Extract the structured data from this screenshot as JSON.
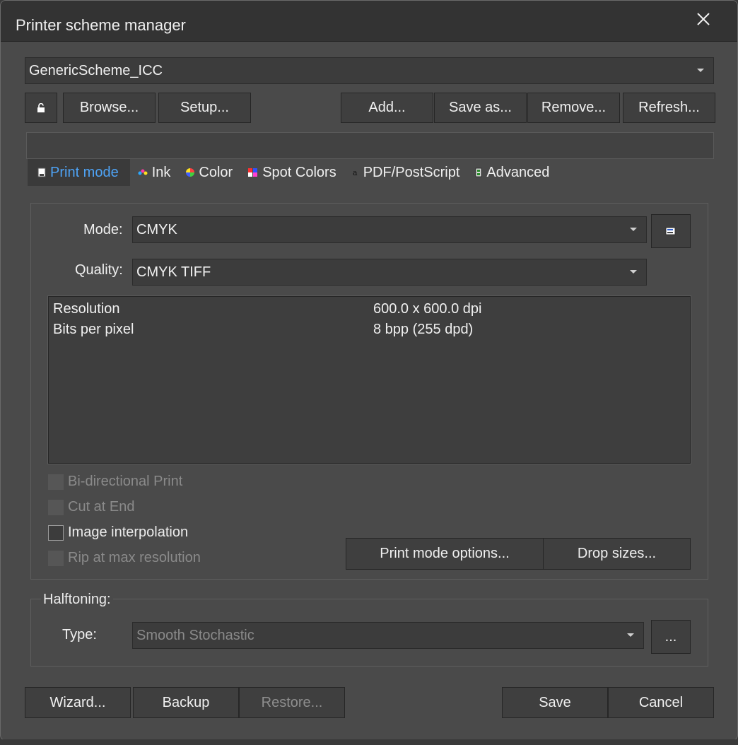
{
  "window": {
    "title": "Printer scheme manager"
  },
  "scheme": {
    "selected": "GenericScheme_ICC"
  },
  "toolbar": {
    "browse": "Browse...",
    "setup": "Setup...",
    "add": "Add...",
    "save_as": "Save as...",
    "remove": "Remove...",
    "refresh": "Refresh..."
  },
  "tabs": [
    {
      "label": "Print mode",
      "icon": "printer-icon"
    },
    {
      "label": "Ink",
      "icon": "ink-drops-icon"
    },
    {
      "label": "Color",
      "icon": "color-wheel-icon"
    },
    {
      "label": "Spot Colors",
      "icon": "spot-colors-icon"
    },
    {
      "label": "PDF/PostScript",
      "icon": "pdf-postscript-icon"
    },
    {
      "label": "Advanced",
      "icon": "advanced-icon"
    }
  ],
  "print_mode": {
    "mode_label": "Mode:",
    "mode_value": "CMYK",
    "quality_label": "Quality:",
    "quality_value": "CMYK TIFF",
    "properties": [
      {
        "name": "Resolution",
        "value": "600.0 x 600.0 dpi"
      },
      {
        "name": "Bits per pixel",
        "value": "8 bpp (255 dpd)"
      }
    ],
    "checkboxes": [
      {
        "label": "Bi-directional Print",
        "checked": false,
        "enabled": false
      },
      {
        "label": "Cut at End",
        "checked": false,
        "enabled": false
      },
      {
        "label": "Image interpolation",
        "checked": false,
        "enabled": true
      },
      {
        "label": "Rip at max resolution",
        "checked": false,
        "enabled": false
      }
    ],
    "options_button": "Print mode options...",
    "drop_sizes_button": "Drop sizes..."
  },
  "halftoning": {
    "legend": "Halftoning:",
    "type_label": "Type:",
    "type_value": "Smooth Stochastic",
    "more_button": "..."
  },
  "footer": {
    "wizard": "Wizard...",
    "backup": "Backup",
    "restore": "Restore...",
    "save": "Save",
    "cancel": "Cancel"
  },
  "colors": {
    "active_tab": "#4ea3f5",
    "window_bg": "#4a4a4a",
    "titlebar_bg": "#333333"
  }
}
